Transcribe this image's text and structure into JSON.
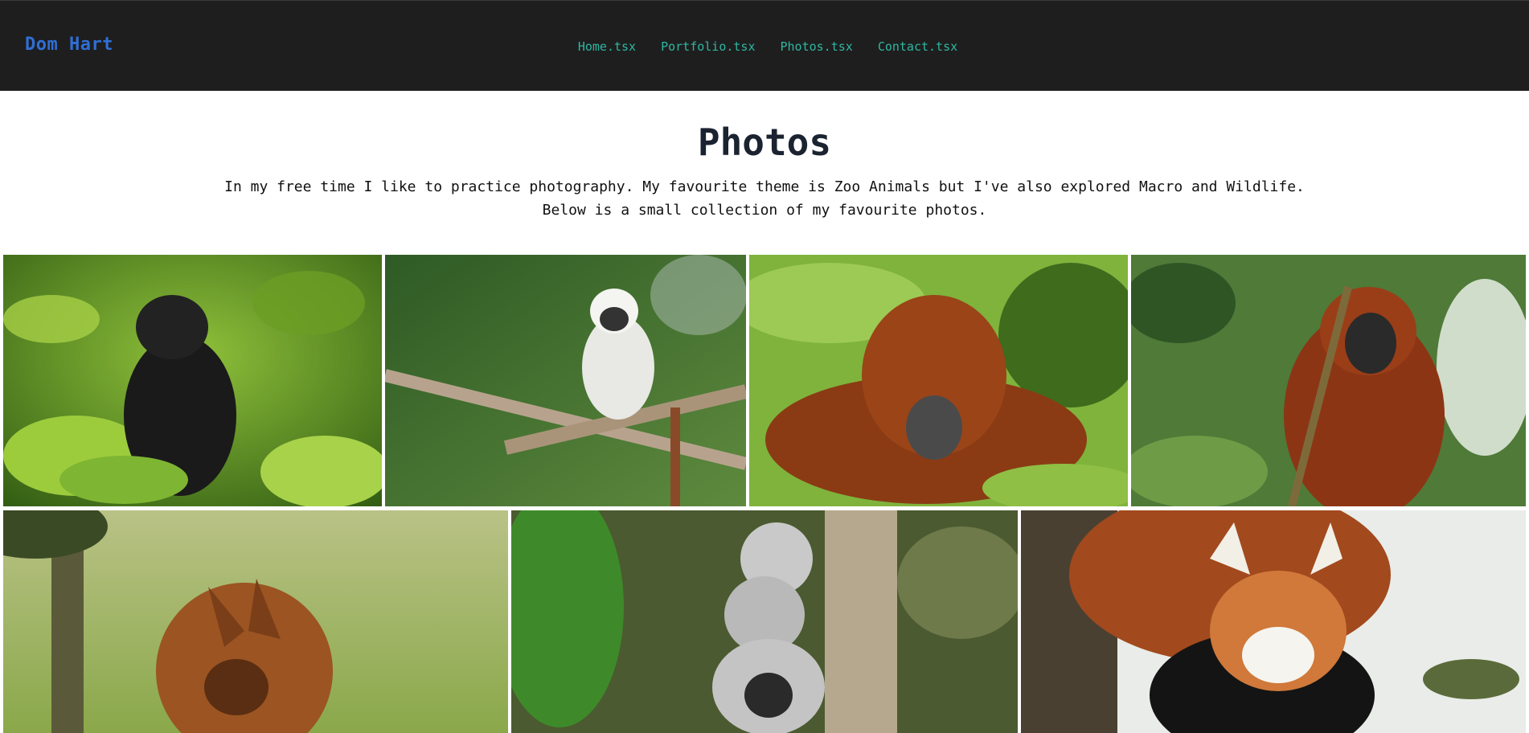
{
  "header": {
    "brand": "Dom Hart",
    "nav": [
      {
        "label": "Home.tsx"
      },
      {
        "label": "Portfolio.tsx"
      },
      {
        "label": "Photos.tsx"
      },
      {
        "label": "Contact.tsx"
      }
    ]
  },
  "page": {
    "title": "Photos",
    "intro_line1": "In my free time I like to practice photography. My favourite theme is Zoo Animals but I've also explored Macro and Wildlife.",
    "intro_line2": "Below is a small collection of my favourite photos."
  },
  "photos": [
    {
      "subject": "black crested macaque among leaves"
    },
    {
      "subject": "cotton-top tamarin on branch"
    },
    {
      "subject": "orangutan lying in grass"
    },
    {
      "subject": "red howler monkey in tree"
    },
    {
      "subject": "maned wolf in meadow"
    },
    {
      "subject": "ring-tailed lemurs stacked on tree"
    },
    {
      "subject": "red panda on log"
    }
  ],
  "colors": {
    "nav_bg": "#1e1e1e",
    "brand": "#2f6fd6",
    "nav_link": "#2fb7a1",
    "title": "#1b2330"
  }
}
